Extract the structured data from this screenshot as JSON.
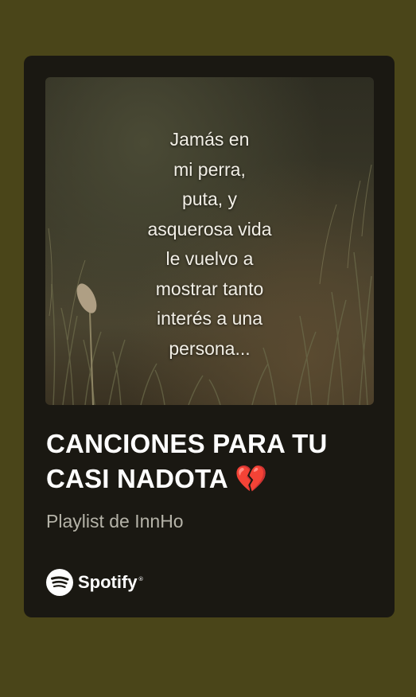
{
  "cover": {
    "quote": "Jamás en\nmi perra,\nputa, y\nasquerosa vida\nle vuelvo a\nmostrar tanto\ninterés a una\npersona..."
  },
  "playlist": {
    "title": "CANCIONES PARA TU\nCASI NADOTA 💔",
    "subtitle": "Playlist de InnHo"
  },
  "brand": {
    "name": "Spotify",
    "trademark": "®",
    "icon": "spotify-logo-icon"
  },
  "colors": {
    "page_background": "#4a4519",
    "card_background": "#1a1812",
    "text_primary": "#ffffff",
    "text_secondary": "#b5b3a8"
  }
}
